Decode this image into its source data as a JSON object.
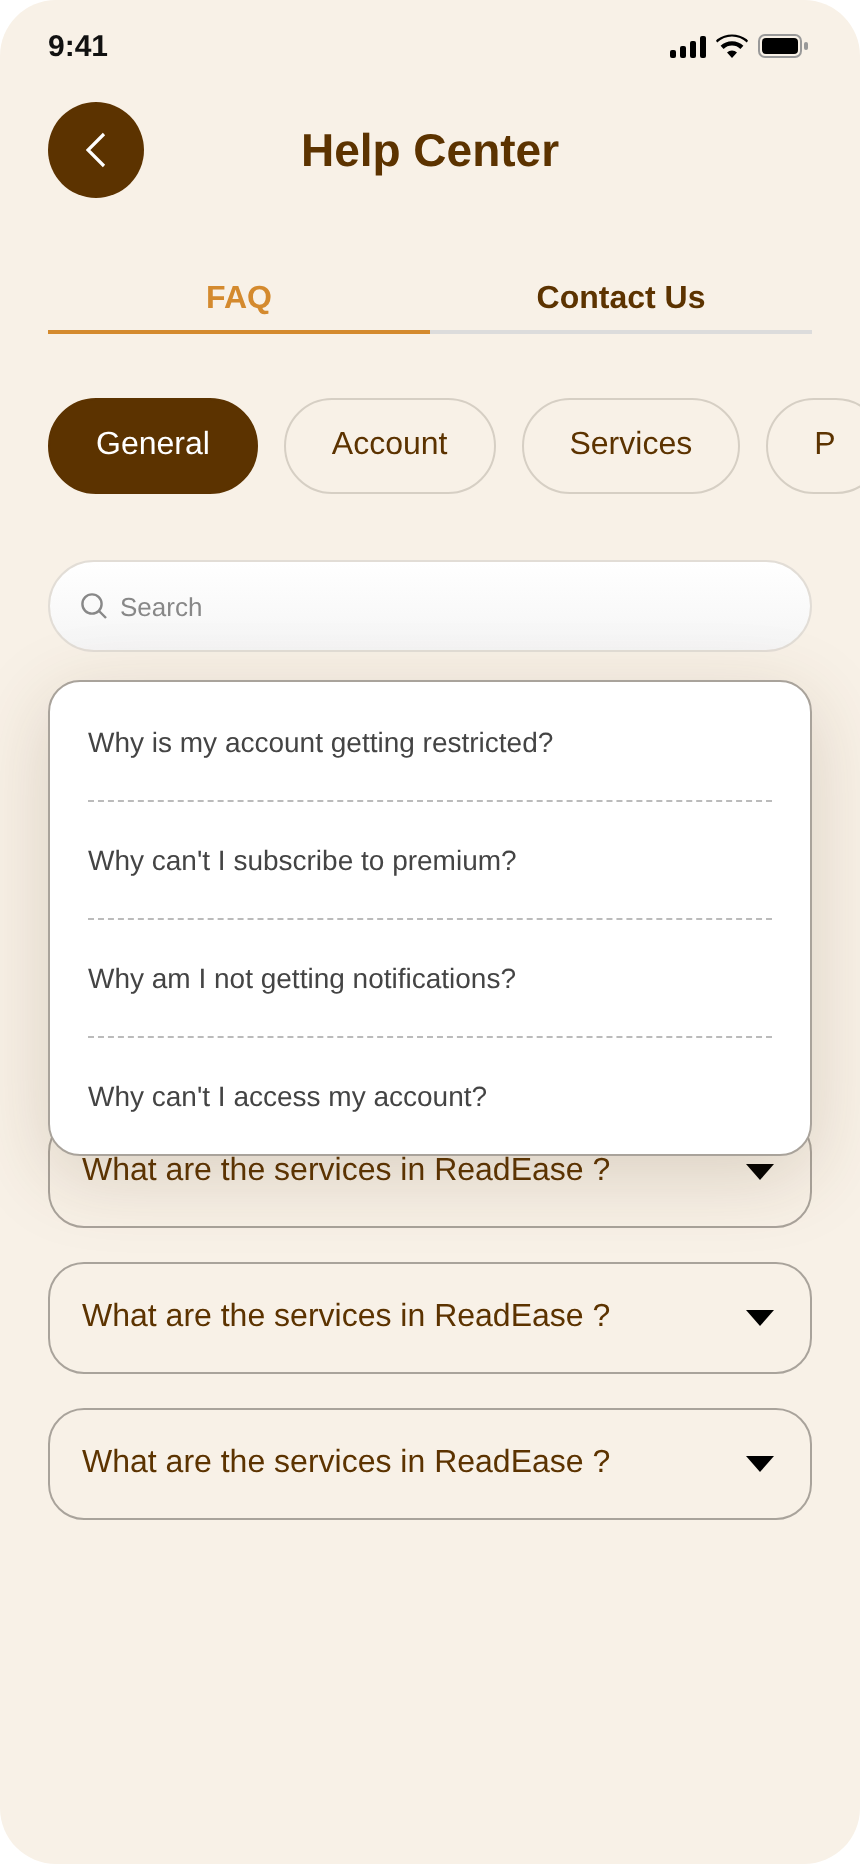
{
  "status_bar": {
    "time": "9:41"
  },
  "header": {
    "title": "Help Center"
  },
  "tabs": [
    {
      "label": "FAQ",
      "selected": true
    },
    {
      "label": "Contact Us",
      "selected": false
    }
  ],
  "categories": [
    {
      "label": "General",
      "selected": true
    },
    {
      "label": "Account",
      "selected": false
    },
    {
      "label": "Services",
      "selected": false
    },
    {
      "label": "P",
      "selected": false
    }
  ],
  "search": {
    "value": "Search"
  },
  "suggestions": [
    "Why is my account getting restricted?",
    "Why can't I subscribe to premium?",
    "Why am I not getting notifications?",
    "Why can't I access my account?"
  ],
  "faqs": [
    {
      "question": "What are the services in ReadEase ?"
    },
    {
      "question": "What are the services in ReadEase ?"
    },
    {
      "question": "What are the services in ReadEase ?"
    }
  ]
}
